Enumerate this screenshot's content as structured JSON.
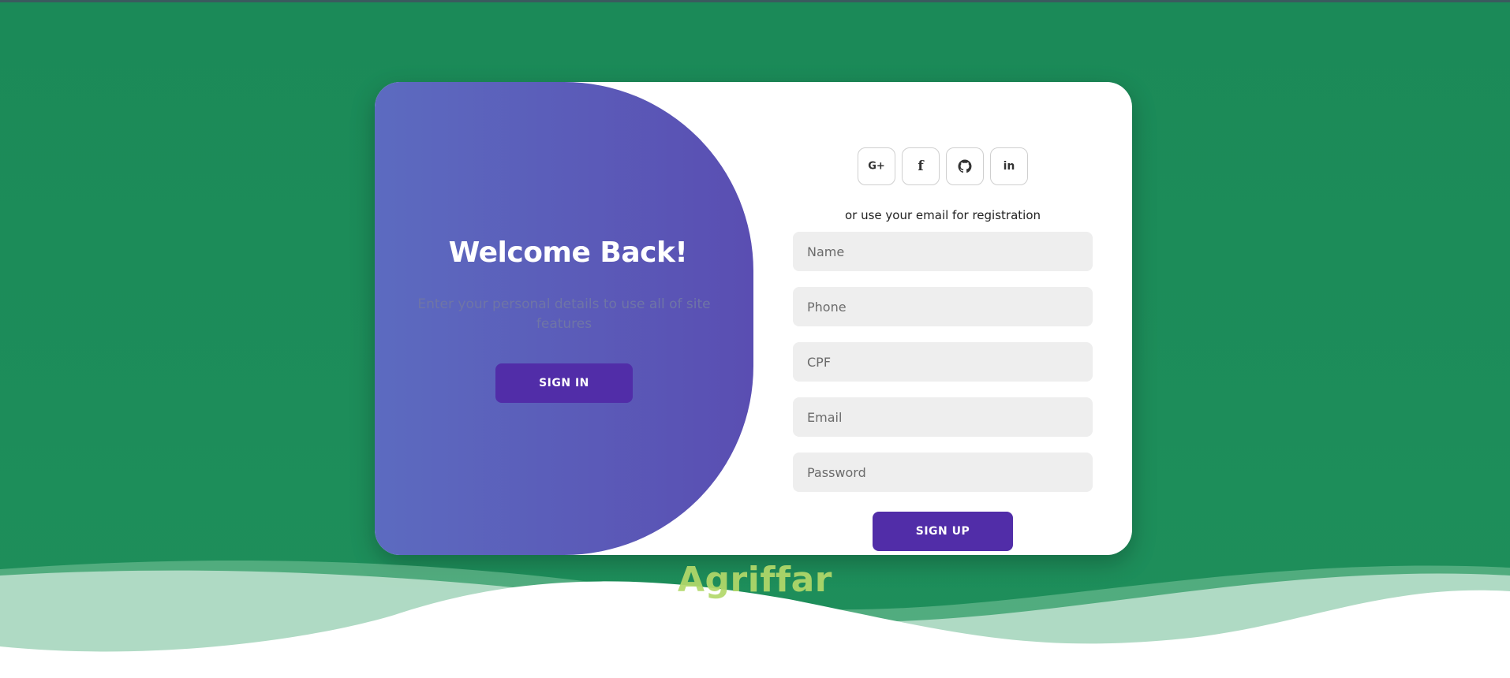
{
  "overlay": {
    "title": "Welcome Back!",
    "subtitle": "Enter your personal details to use all of site features",
    "signin_label": "SIGN IN"
  },
  "social": [
    {
      "icon": "google-plus-icon",
      "glyph": "G+"
    },
    {
      "icon": "facebook-icon",
      "glyph": "f"
    },
    {
      "icon": "github-icon",
      "glyph": ""
    },
    {
      "icon": "linkedin-icon",
      "glyph": "in"
    }
  ],
  "form": {
    "subtitle": "or use your email for registration",
    "fields": [
      {
        "placeholder": "Name"
      },
      {
        "placeholder": "Phone"
      },
      {
        "placeholder": "CPF"
      },
      {
        "placeholder": "Email"
      },
      {
        "placeholder": "Password"
      }
    ],
    "signup_label": "SIGN UP"
  },
  "brand": "Agriffar",
  "colors": {
    "background": "#1b8a58",
    "overlay_start": "#5c6bc0",
    "overlay_end": "#5a4eb2",
    "button": "#512da8",
    "brand_text": "#b3d96a"
  }
}
